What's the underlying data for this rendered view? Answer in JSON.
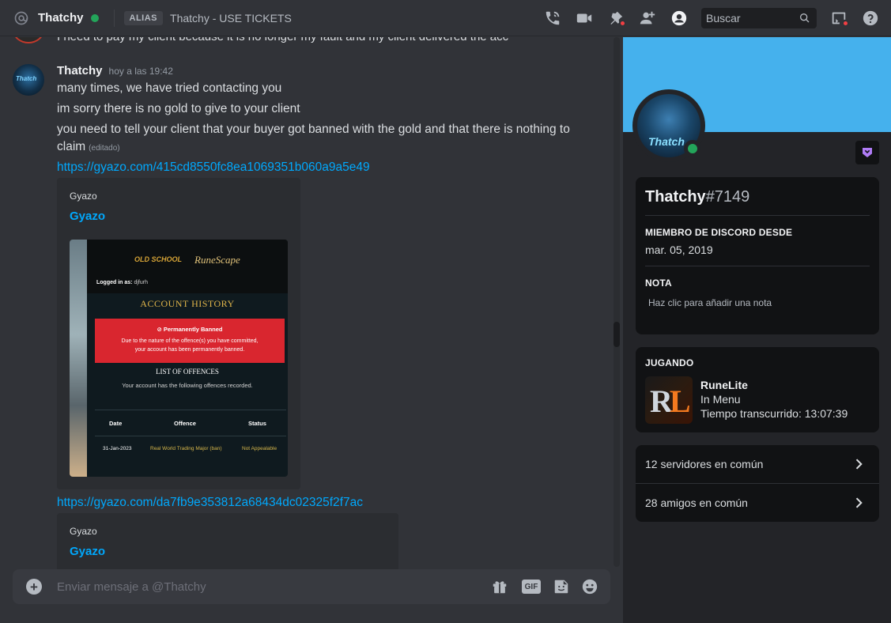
{
  "header": {
    "username": "Thatchy",
    "alias_badge": "ALIAS",
    "alias_text": "Thatchy - USE TICKETS",
    "search_placeholder": "Buscar",
    "icons": [
      "at-icon",
      "phone-call-icon",
      "video-call-icon",
      "pin-icon",
      "add-friend-icon",
      "profile-toggle-icon",
      "search-icon",
      "inbox-icon",
      "help-icon"
    ]
  },
  "chat": {
    "prev_message": "I need to pay my client because it is no longer my fault and my client delivered the acc",
    "message": {
      "author": "Thatchy",
      "time": "hoy a las 19:42",
      "lines": [
        "many times, we have tried contacting you",
        "im sorry there is no gold to give to your client",
        "you need to tell your client that your buyer got banned with the gold and that there is nothing to",
        "claim"
      ],
      "edited_label": "(editado)",
      "link1": "https://gyazo.com/415cd8550fc8ea1069351b060a9a5e49",
      "embed1": {
        "provider": "Gyazo",
        "title": "Gyazo",
        "screenshot": {
          "logged_label": "Logged in as:",
          "logged_user": "djfurh",
          "heading": "ACCOUNT HISTORY",
          "ban_title": "Permanently Banned",
          "ban_desc_1": "Due to the nature of the offence(s) you have committed,",
          "ban_desc_2": "your account has been permanently banned.",
          "offences_title": "LIST OF OFFENCES",
          "offences_sub": "Your account has the following offences recorded.",
          "col_date": "Date",
          "col_offence": "Offence",
          "col_status": "Status",
          "row_date": "31-Jan-2023",
          "row_offence": "Real World Trading Major (ban)",
          "row_status": "Not Appealable",
          "logo_left": "OLD SCHOOL",
          "logo_right": "RuneScape"
        }
      },
      "link2": "https://gyazo.com/da7fb9e353812a68434dc02325f2f7ac",
      "embed2": {
        "provider": "Gyazo",
        "title": "Gyazo"
      }
    },
    "composer_placeholder": "Enviar mensaje a @Thatchy"
  },
  "profile": {
    "display_name": "Thatchy",
    "discriminator": "#7149",
    "member_since_title": "MIEMBRO DE DISCORD DESDE",
    "member_since": "mar. 05, 2019",
    "note_title": "NOTA",
    "note_placeholder": "Haz clic para añadir una nota",
    "playing_title": "JUGANDO",
    "game_name": "RuneLite",
    "game_state": "In Menu",
    "game_time": "Tiempo transcurrido: 13:07:39",
    "mutual_servers": "12 servidores en común",
    "mutual_friends": "28 amigos en común"
  },
  "colors": {
    "banner": "#45b1ed",
    "online": "#23a55a",
    "link": "#00a8fc",
    "danger": "#f23f43"
  }
}
